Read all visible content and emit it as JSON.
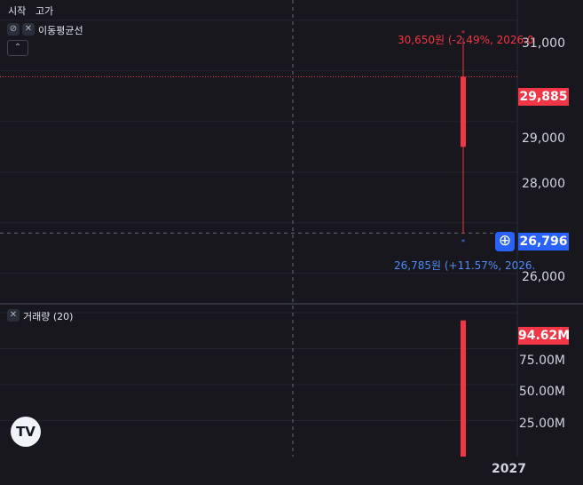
{
  "toolbar": {
    "open_label": "시작",
    "high_label": "고가"
  },
  "ma_legend": {
    "title": "이동평균선",
    "visibility_icon": "eye-off-icon",
    "close_icon": "close-icon",
    "collapse_icon": "chevron-up-icon"
  },
  "volume_legend": {
    "title": "거래량 (20)",
    "close_icon": "close-icon"
  },
  "price_axis": {
    "ticks": [
      "31,000",
      "29,000",
      "28,000",
      "26,000"
    ]
  },
  "volume_axis": {
    "ticks": [
      "75.00M",
      "50.00M",
      "25.00M"
    ]
  },
  "badges": {
    "last_price": "29,885",
    "crosshair_price": "26,796",
    "volume": "94.62M"
  },
  "annotations": {
    "high": "30,650원 (-2.49%, 2026.0",
    "low": "26,785원 (+11.57%, 2026."
  },
  "time_axis": {
    "label": "2027"
  },
  "colors": {
    "background": "#17171d",
    "down_candle": "#f23645",
    "crosshair_badge": "#2962ff"
  },
  "chart_data": {
    "type": "candlestick",
    "price_candles": [
      {
        "open": 29885,
        "high": 30650,
        "low": 26785,
        "close": 28500
      }
    ],
    "last_price": 29885,
    "crosshair_price": 26796,
    "price_ylim": [
      25400,
      31400
    ],
    "volume": [
      {
        "value": 94.62,
        "unit": "M"
      }
    ],
    "volume_ylim": [
      0,
      100
    ]
  }
}
